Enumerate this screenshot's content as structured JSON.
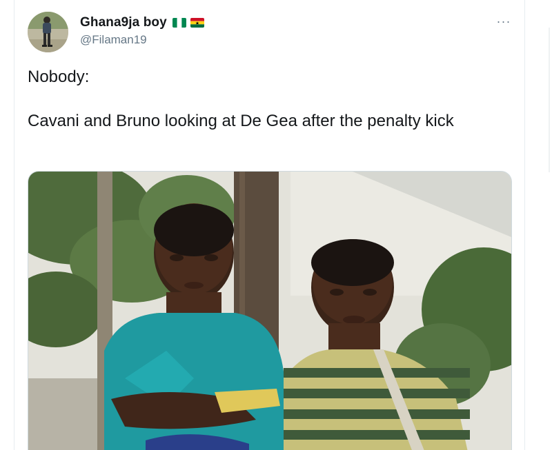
{
  "tweet": {
    "display_name": "Ghana9ja boy",
    "handle": "@Filaman19",
    "more_label": "···",
    "text_line1": "Nobody:",
    "text_line2": "Cavani and Bruno looking at De Gea after the penalty kick"
  },
  "icons": {
    "flag_1": "nigeria-flag-icon",
    "flag_2": "ghana-flag-icon",
    "more": "more-options-icon"
  },
  "colors": {
    "text_primary": "#14171a",
    "text_secondary": "#657786",
    "border": "#cfd9de"
  }
}
